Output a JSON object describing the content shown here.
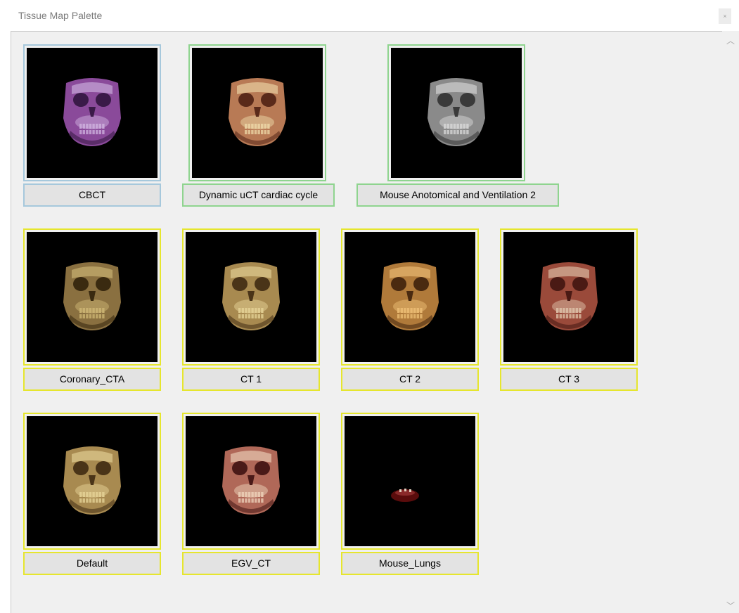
{
  "window": {
    "title": "Tissue Map Palette",
    "close_glyph": "×"
  },
  "colors": {
    "selected_border": "#a6c8dc",
    "active_border": "#8fd48f",
    "default_border": "#e6e62e"
  },
  "scrollbar": {
    "up_glyph": "︿",
    "down_glyph": "﹀"
  },
  "tiles": [
    {
      "label": "CBCT",
      "state": "selected",
      "tint": "purple"
    },
    {
      "label": "Dynamic uCT cardiac cycle",
      "state": "active",
      "tint": "flesh"
    },
    {
      "label": "Mouse Anotomical and Ventilation 2",
      "state": "active",
      "tint": "gray"
    },
    {
      "label": "Coronary_CTA",
      "state": "default",
      "tint": "dark-bone"
    },
    {
      "label": "CT 1",
      "state": "default",
      "tint": "bone"
    },
    {
      "label": "CT 2",
      "state": "default",
      "tint": "orange"
    },
    {
      "label": "CT 3",
      "state": "default",
      "tint": "red-bone"
    },
    {
      "label": "Default",
      "state": "default",
      "tint": "bone"
    },
    {
      "label": "EGV_CT",
      "state": "default",
      "tint": "pink"
    },
    {
      "label": "Mouse_Lungs",
      "state": "default",
      "tint": "red-spot"
    }
  ]
}
